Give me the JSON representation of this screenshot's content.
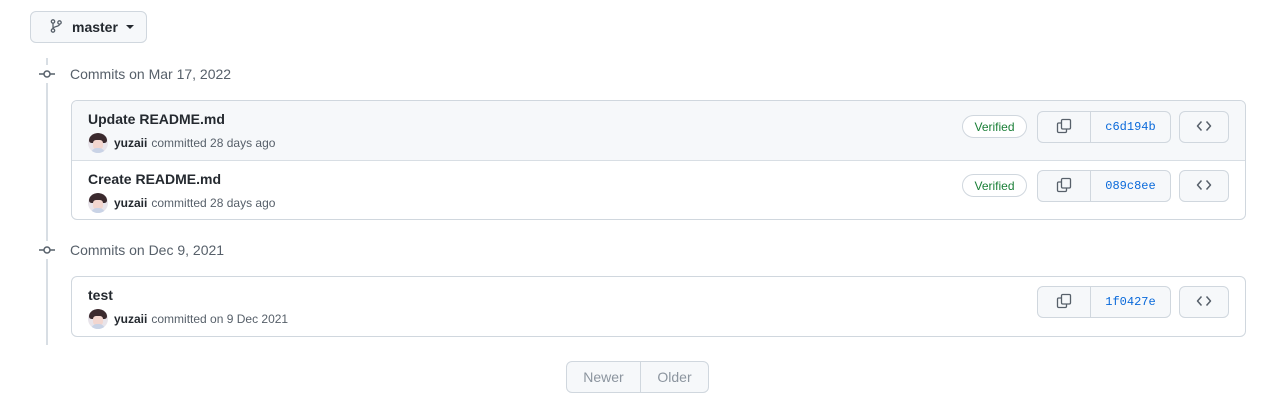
{
  "branch": {
    "name": "master"
  },
  "groups": [
    {
      "title": "Commits on Mar 17, 2022",
      "commits": [
        {
          "message": "Update README.md",
          "author": "yuzaii",
          "meta": "committed 28 days ago",
          "verified": "Verified",
          "sha": "c6d194b"
        },
        {
          "message": "Create README.md",
          "author": "yuzaii",
          "meta": "committed 28 days ago",
          "verified": "Verified",
          "sha": "089c8ee"
        }
      ]
    },
    {
      "title": "Commits on Dec 9, 2021",
      "commits": [
        {
          "message": "test",
          "author": "yuzaii",
          "meta": "committed on 9 Dec 2021",
          "sha": "1f0427e"
        }
      ]
    }
  ],
  "pagination": {
    "newer": "Newer",
    "older": "Older"
  },
  "colors": {
    "verified": "#1a7f37",
    "sha_link": "#0969da",
    "border": "#d0d7de",
    "highlight_row": "#f6f8fa"
  },
  "icons": {
    "branch": "git-branch-icon",
    "copy": "copy-icon",
    "code": "code-icon",
    "commit": "git-commit-icon"
  }
}
